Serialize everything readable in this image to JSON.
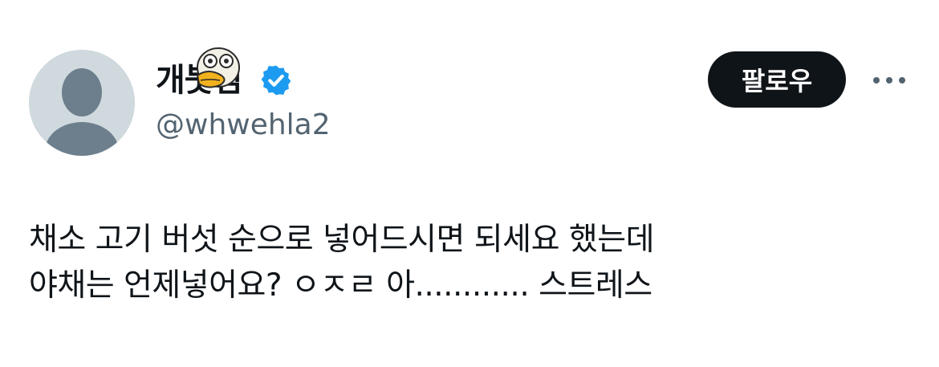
{
  "author": {
    "display_name": "개붓짐",
    "handle": "@whwehla2",
    "verified": true,
    "avatar": "default-profile-silhouette",
    "name_sticker": "duck-emoji-sticker"
  },
  "actions": {
    "follow_label": "팔로우",
    "more_icon": "more-horizontal-icon"
  },
  "tweet": {
    "text": "채소 고기 버섯 순으로 넣어드시면 되세요 했는데\n야채는 언제넣어요? ㅇㅈㄹ 아............ 스트레스"
  },
  "colors": {
    "verified_blue": "#1d9bf0",
    "follow_button_bg": "#0f1419",
    "handle_gray": "#536471",
    "avatar_bg": "#cfd9de",
    "avatar_silhouette": "#6d7f8d"
  }
}
